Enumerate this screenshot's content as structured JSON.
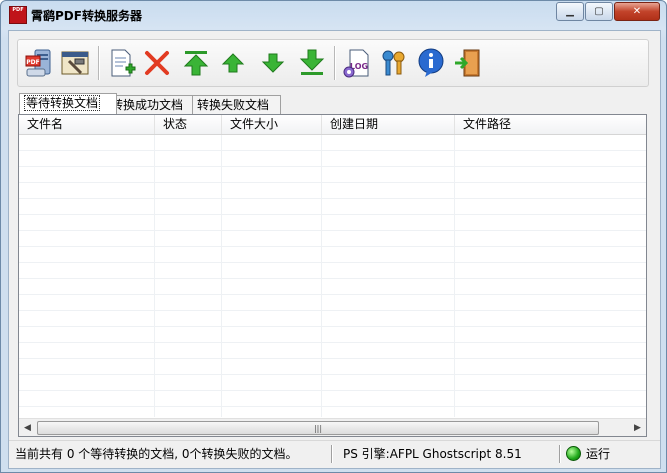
{
  "window": {
    "title": "霄鹞PDF转换服务器",
    "app_icon_text": "PDF",
    "controls": [
      "minimize",
      "maximize",
      "close"
    ]
  },
  "toolbar": {
    "buttons": [
      {
        "name": "pdf-server-icon",
        "tooltip": ""
      },
      {
        "name": "settings-tools-icon",
        "tooltip": ""
      },
      {
        "name": "add-document-icon",
        "tooltip": ""
      },
      {
        "name": "delete-icon",
        "tooltip": ""
      },
      {
        "name": "move-top-icon",
        "tooltip": ""
      },
      {
        "name": "move-up-icon",
        "tooltip": ""
      },
      {
        "name": "move-down-icon",
        "tooltip": ""
      },
      {
        "name": "move-bottom-icon",
        "tooltip": ""
      },
      {
        "name": "log-icon",
        "tooltip": ""
      },
      {
        "name": "user-key-icon",
        "tooltip": ""
      },
      {
        "name": "info-icon",
        "tooltip": ""
      },
      {
        "name": "exit-icon",
        "tooltip": ""
      }
    ],
    "log_label": "LOG"
  },
  "tabs": [
    {
      "label": "等待转换文档",
      "active": true
    },
    {
      "label": "转换成功文档",
      "active": false
    },
    {
      "label": "转换失败文档",
      "active": false
    }
  ],
  "table": {
    "columns": [
      "文件名",
      "状态",
      "文件大小",
      "创建日期",
      "文件路径"
    ],
    "rows": []
  },
  "scrollbar": {
    "grip": "|||"
  },
  "status": {
    "message": "当前共有 0 个等待转换的文档, 0个转换失败的文档。",
    "engine": "PS 引擎:AFPL Ghostscript 8.51",
    "state": "运行",
    "state_color": "#1fa81a"
  }
}
